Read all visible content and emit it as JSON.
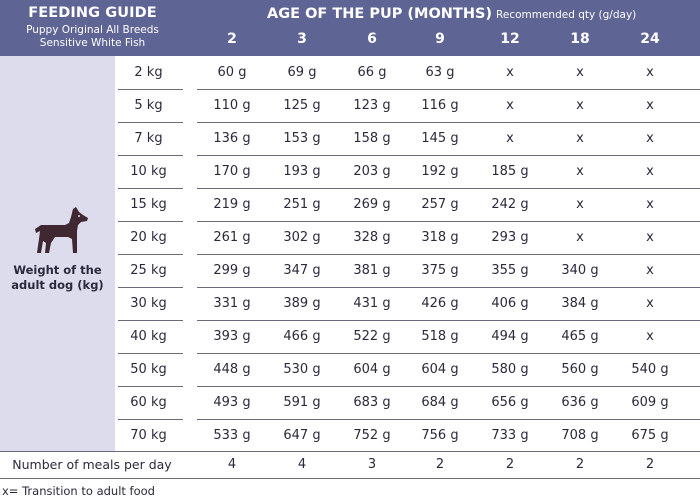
{
  "header": {
    "title": "FEEDING GUIDE",
    "subtitle_line1": "Puppy Original All Breeds",
    "subtitle_line2": "Sensitive White Fish",
    "age_title": "AGE OF THE PUP (MONTHS)",
    "age_subtitle": "Recommended qty (g/day)",
    "age_columns": [
      "2",
      "3",
      "6",
      "9",
      "12",
      "18",
      "24"
    ]
  },
  "left_panel": {
    "icon": "dog-icon",
    "label_line1": "Weight of the",
    "label_line2": "adult dog (kg)"
  },
  "rows": [
    {
      "weight": "2 kg",
      "values": [
        "60 g",
        "69 g",
        "66 g",
        "63 g",
        "x",
        "x",
        "x"
      ]
    },
    {
      "weight": "5 kg",
      "values": [
        "110 g",
        "125 g",
        "123 g",
        "116 g",
        "x",
        "x",
        "x"
      ]
    },
    {
      "weight": "7 kg",
      "values": [
        "136 g",
        "153 g",
        "158 g",
        "145 g",
        "x",
        "x",
        "x"
      ]
    },
    {
      "weight": "10 kg",
      "values": [
        "170 g",
        "193 g",
        "203 g",
        "192 g",
        "185 g",
        "x",
        "x"
      ]
    },
    {
      "weight": "15 kg",
      "values": [
        "219 g",
        "251 g",
        "269 g",
        "257 g",
        "242 g",
        "x",
        "x"
      ]
    },
    {
      "weight": "20 kg",
      "values": [
        "261 g",
        "302 g",
        "328 g",
        "318 g",
        "293 g",
        "x",
        "x"
      ]
    },
    {
      "weight": "25 kg",
      "values": [
        "299 g",
        "347 g",
        "381 g",
        "375 g",
        "355 g",
        "340 g",
        "x"
      ]
    },
    {
      "weight": "30 kg",
      "values": [
        "331 g",
        "389 g",
        "431 g",
        "426 g",
        "406 g",
        "384 g",
        "x"
      ]
    },
    {
      "weight": "40 kg",
      "values": [
        "393 g",
        "466 g",
        "522 g",
        "518 g",
        "494 g",
        "465 g",
        "x"
      ]
    },
    {
      "weight": "50 kg",
      "values": [
        "448 g",
        "530 g",
        "604 g",
        "604 g",
        "580 g",
        "560 g",
        "540 g"
      ]
    },
    {
      "weight": "60 kg",
      "values": [
        "493 g",
        "591 g",
        "683 g",
        "684 g",
        "656 g",
        "636 g",
        "609 g"
      ]
    },
    {
      "weight": "70 kg",
      "values": [
        "533 g",
        "647 g",
        "752 g",
        "756 g",
        "733 g",
        "708 g",
        "675 g"
      ]
    }
  ],
  "meals": {
    "label": "Number of meals per day",
    "values": [
      "4",
      "4",
      "3",
      "2",
      "2",
      "2",
      "2"
    ]
  },
  "footnote": "x= Transition to adult food",
  "colors": {
    "header_bg": "#5e6494",
    "panel_bg": "#dcdcec",
    "dog_icon": "#3f2832",
    "text": "#2a2a3d"
  }
}
